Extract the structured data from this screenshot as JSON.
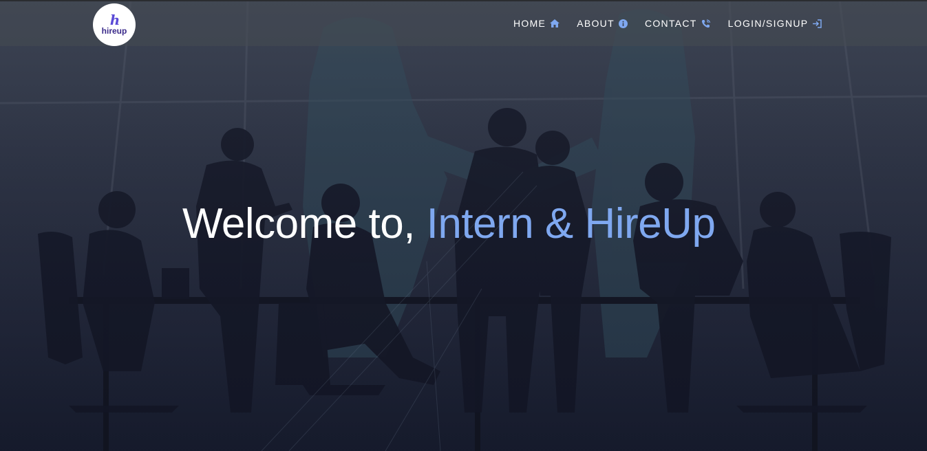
{
  "logo": {
    "mark": "h",
    "text": "hireup"
  },
  "nav": {
    "items": [
      {
        "label": "HOME",
        "icon": "home-icon"
      },
      {
        "label": "ABOUT",
        "icon": "info-icon"
      },
      {
        "label": "CONTACT",
        "icon": "phone-icon"
      },
      {
        "label": "LOGIN/SIGNUP",
        "icon": "login-icon"
      }
    ]
  },
  "hero": {
    "prefix": "Welcome to, ",
    "highlight": "Intern & HireUp"
  },
  "colors": {
    "accent": "#7fa8f0",
    "nav_bg": "#464a52",
    "bg_dark": "#1f2436"
  }
}
